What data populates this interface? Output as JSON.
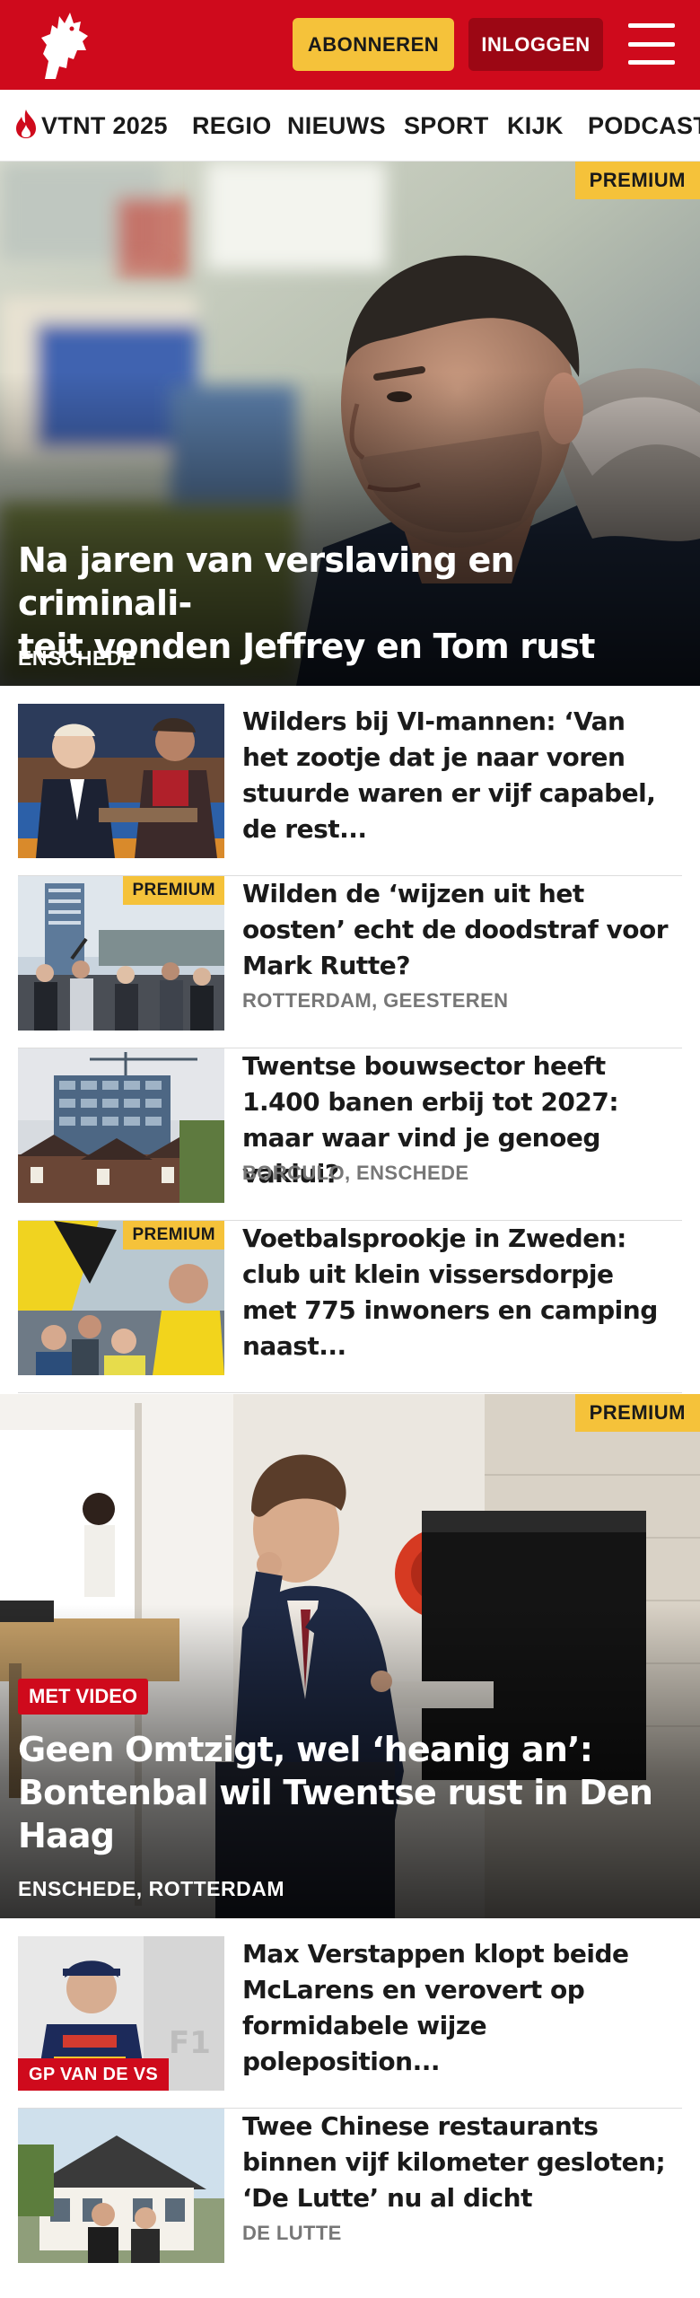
{
  "header": {
    "subscribe_label": "ABONNEREN",
    "login_label": "INLOGGEN"
  },
  "nav": {
    "items": [
      "VTNT 2025",
      "REGIO",
      "NIEUWS",
      "SPORT",
      "KIJK",
      "PODCAST"
    ]
  },
  "colors": {
    "brand_red": "#cf0a1c",
    "premium_yellow": "#f5c23a"
  },
  "hero1": {
    "badge": "PREMIUM",
    "title": "Na jaren van verslaving en criminaliteit vonden Jeffrey en Tom rust",
    "title_line1": "Na jaren van verslaving en criminali-",
    "title_line2": "teit vonden Jeffrey en Tom rust",
    "location": "ENSCHEDE"
  },
  "articles": [
    {
      "title": "Wilders bij VI-mannen: ‘Van het zootje dat je naar voren stuurde waren er vijf capabel, de rest...",
      "location": ""
    },
    {
      "badge": "PREMIUM",
      "title": "Wilden de ‘wijzen uit het oosten’ echt de doodstraf voor Mark Rutte?",
      "location": "ROTTERDAM, GEESTEREN"
    },
    {
      "title": "Twentse bouwsector heeft 1.400 banen erbij tot 2027: maar waar vind je genoeg vaklui?",
      "location": "BORCULO, ENSCHEDE"
    },
    {
      "badge": "PREMIUM",
      "title": "Voetbalsprookje in Zweden: club uit klein vissersdorpje met 775 inwoners en camping naast...",
      "location": ""
    }
  ],
  "hero2": {
    "badge": "PREMIUM",
    "video_label": "MET VIDEO",
    "title": "Geen Omtzigt, wel ‘heanig an’: Bontenbal wil Twentse rust in Den Haag",
    "location": "ENSCHEDE, ROTTERDAM"
  },
  "articles2": [
    {
      "tag": "GP VAN DE VS",
      "title": "Max Verstappen klopt beide McLarens en verovert op formidabele wijze poleposition...",
      "location": ""
    },
    {
      "title": "Twee Chinese restaurants binnen vijf kilometer gesloten; ‘De Lutte’ nu al dicht",
      "location": "DE LUTTE"
    }
  ]
}
